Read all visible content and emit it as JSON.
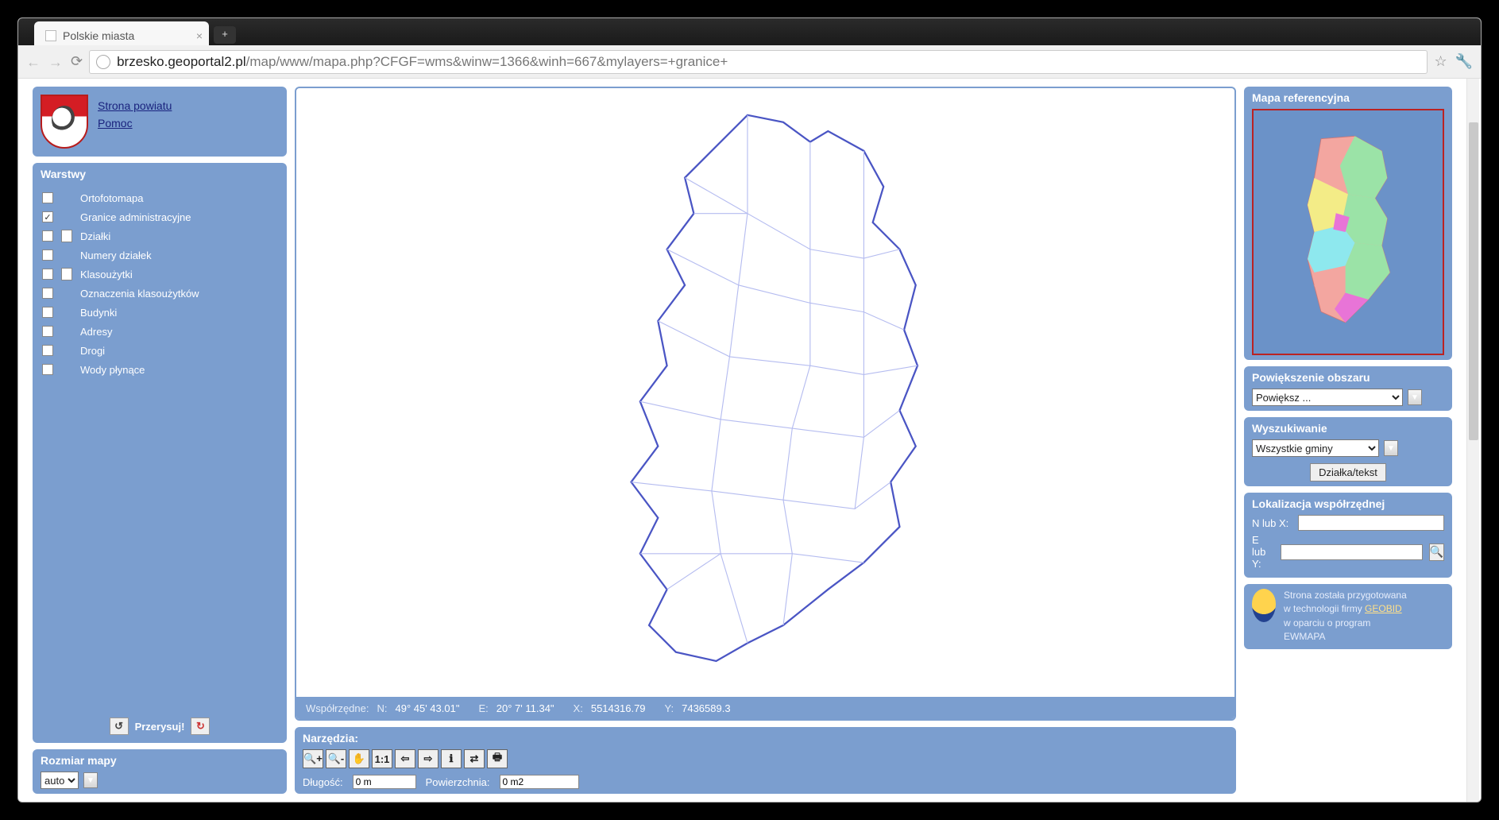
{
  "browser": {
    "tab_title": "Polskie miasta",
    "url_domain": "brzesko.geoportal2.pl",
    "url_path": "/map/www/mapa.php?CFGF=wms&winw=1366&winh=667&mylayers=+granice+"
  },
  "top_links": {
    "site": "Strona powiatu",
    "help": "Pomoc"
  },
  "layers": {
    "title": "Warstwy",
    "items": [
      {
        "label": "Ortofotomapa",
        "checked": false,
        "doc": false
      },
      {
        "label": "Granice administracyjne",
        "checked": true,
        "doc": false
      },
      {
        "label": "Działki",
        "checked": false,
        "doc": true
      },
      {
        "label": "Numery działek",
        "checked": false,
        "doc": false
      },
      {
        "label": "Klasoużytki",
        "checked": false,
        "doc": true
      },
      {
        "label": "Oznaczenia klasoużytków",
        "checked": false,
        "doc": false
      },
      {
        "label": "Budynki",
        "checked": false,
        "doc": false
      },
      {
        "label": "Adresy",
        "checked": false,
        "doc": false
      },
      {
        "label": "Drogi",
        "checked": false,
        "doc": false
      },
      {
        "label": "Wody płynące",
        "checked": false,
        "doc": false
      }
    ],
    "redraw": "Przerysuj!"
  },
  "map_size": {
    "title": "Rozmiar mapy",
    "value": "auto"
  },
  "coords": {
    "label": "Współrzędne:",
    "n_lbl": "N:",
    "n_val": "49° 45' 43.01\"",
    "e_lbl": "E:",
    "e_val": "20° 7' 11.34\"",
    "x_lbl": "X:",
    "x_val": "5514316.79",
    "y_lbl": "Y:",
    "y_val": "7436589.3"
  },
  "tools": {
    "title": "Narzędzia:",
    "length_lbl": "Długość:",
    "length_val": "0 m",
    "area_lbl": "Powierzchnia:",
    "area_val": "0 m2"
  },
  "refmap_title": "Mapa referencyjna",
  "zoom_area": {
    "title": "Powiększenie obszaru",
    "selected": "Powiększ ..."
  },
  "search": {
    "title": "Wyszukiwanie",
    "selected": "Wszystkie gminy",
    "button": "Działka/tekst"
  },
  "locate": {
    "title": "Lokalizacja współrzędnej",
    "n_label": "N lub X:",
    "e_label": "E lub Y:"
  },
  "credits": {
    "line1": "Strona została przygotowana",
    "line2a": "w technologii firmy ",
    "geobid": "GEOBID",
    "line3": "w oparciu o program",
    "line4": "EWMAPA"
  }
}
